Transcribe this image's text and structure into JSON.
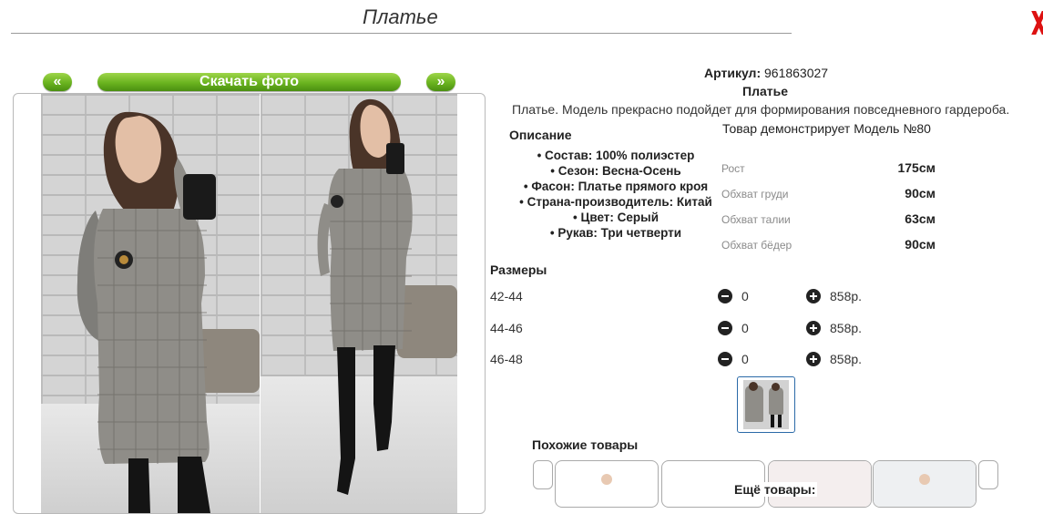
{
  "page": {
    "title": "Платье"
  },
  "gallery": {
    "prev_label": "«",
    "download_label": "Скачать фото",
    "next_label": "»"
  },
  "product": {
    "sku_label": "Артикул:",
    "sku_value": "961863027",
    "name": "Платье",
    "description": "Платье. Модель прекрасно подойдет для формирования повседневного гардероба.",
    "model_note": "Товар демонстрирует Модель №80"
  },
  "description_section": {
    "heading": "Описание",
    "attributes": [
      "Состав: 100% полиэстер",
      "Сезон: Весна-Осень",
      "Фасон: Платье прямого кроя",
      "Страна-производитель: Китай",
      "Цвет: Серый",
      "Рукав: Три четверти"
    ]
  },
  "measurements": [
    {
      "label": "Рост",
      "value": "175см"
    },
    {
      "label": "Обхват груди",
      "value": "90см"
    },
    {
      "label": "Обхват талии",
      "value": "63см"
    },
    {
      "label": "Обхват бёдер",
      "value": "90см"
    }
  ],
  "sizes": {
    "heading": "Размеры",
    "rows": [
      {
        "size": "42-44",
        "qty": "0",
        "price": "858р."
      },
      {
        "size": "44-46",
        "qty": "0",
        "price": "858р."
      },
      {
        "size": "46-48",
        "qty": "0",
        "price": "858р."
      }
    ]
  },
  "similar": {
    "heading": "Похожие товары",
    "more_heading": "Ещё товары:"
  },
  "colors": {
    "accent_green": "#6ab31f",
    "close_red": "#dd1111",
    "thumb_border": "#2b6aa8"
  },
  "icons": [
    "close-icon",
    "minus-icon",
    "plus-icon"
  ]
}
